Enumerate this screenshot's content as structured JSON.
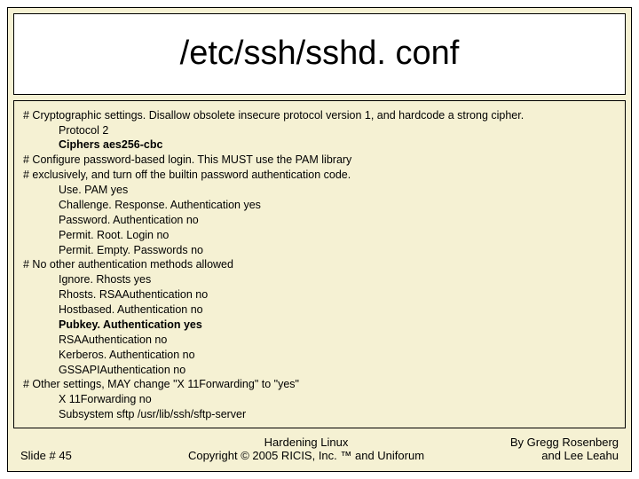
{
  "title": "/etc/ssh/sshd. conf",
  "content": {
    "lines": [
      {
        "text": "# Cryptographic settings. Disallow obsolete insecure protocol version 1, and hardcode a strong cipher.",
        "indent": 0,
        "bold": false
      },
      {
        "text": "Protocol 2",
        "indent": 1,
        "bold": false
      },
      {
        "text": "Ciphers aes256-cbc",
        "indent": 1,
        "bold": true
      },
      {
        "text": "# Configure password-based login. This MUST use the PAM library",
        "indent": 0,
        "bold": false
      },
      {
        "text": "# exclusively, and turn off the builtin password authentication code.",
        "indent": 0,
        "bold": false
      },
      {
        "text": "Use. PAM yes",
        "indent": 1,
        "bold": false
      },
      {
        "text": "Challenge. Response. Authentication yes",
        "indent": 1,
        "bold": false
      },
      {
        "text": "Password. Authentication no",
        "indent": 1,
        "bold": false
      },
      {
        "text": "Permit. Root. Login no",
        "indent": 1,
        "bold": false
      },
      {
        "text": "Permit. Empty. Passwords no",
        "indent": 1,
        "bold": false
      },
      {
        "text": "# No other authentication methods allowed",
        "indent": 0,
        "bold": false
      },
      {
        "text": "Ignore. Rhosts yes",
        "indent": 1,
        "bold": false
      },
      {
        "text": "Rhosts. RSAAuthentication no",
        "indent": 1,
        "bold": false
      },
      {
        "text": "Hostbased. Authentication no",
        "indent": 1,
        "bold": false
      },
      {
        "text": "Pubkey. Authentication yes",
        "indent": 1,
        "bold": true
      },
      {
        "text": "RSAAuthentication no",
        "indent": 1,
        "bold": false
      },
      {
        "text": "Kerberos. Authentication no",
        "indent": 1,
        "bold": false
      },
      {
        "text": "GSSAPIAuthentication no",
        "indent": 1,
        "bold": false
      },
      {
        "text": "# Other settings, MAY change \"X 11Forwarding\" to \"yes\"",
        "indent": 0,
        "bold": false
      },
      {
        "text": "X 11Forwarding no",
        "indent": 1,
        "bold": false
      },
      {
        "text": "Subsystem sftp /usr/lib/ssh/sftp-server",
        "indent": 1,
        "bold": false
      }
    ]
  },
  "footer": {
    "slide_num": "Slide # 45",
    "center_line1": "Hardening Linux",
    "center_line2": "Copyright © 2005 RICIS, Inc. ™ and Uniforum",
    "author_line1": "By Gregg Rosenberg",
    "author_line2": "and Lee Leahu"
  }
}
